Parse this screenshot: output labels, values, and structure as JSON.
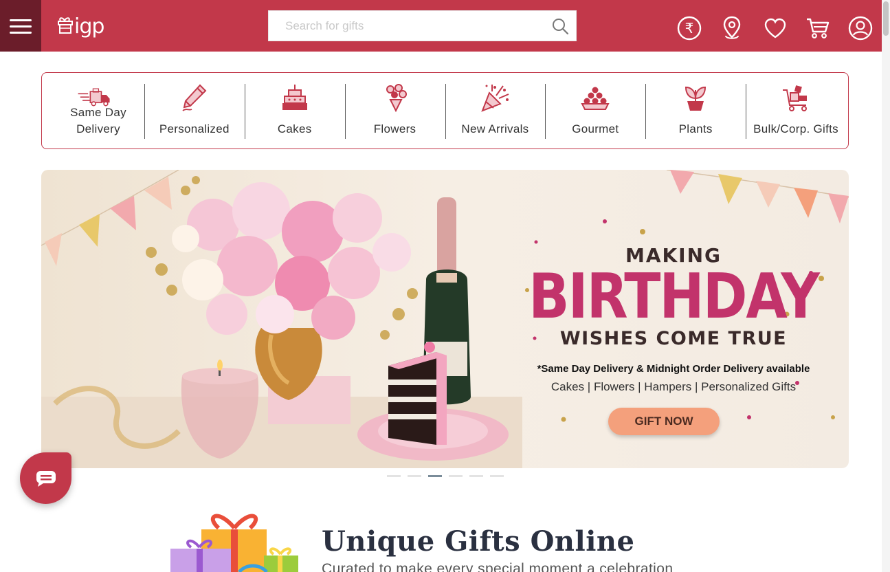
{
  "header": {
    "logo_text": "igp",
    "search_placeholder": "Search for gifts",
    "icons": [
      "currency-rupee-icon",
      "location-pin-icon",
      "heart-icon",
      "cart-icon",
      "user-icon"
    ]
  },
  "categories": [
    {
      "label": "Same Day Delivery",
      "icon": "delivery-truck-icon"
    },
    {
      "label": "Personalized",
      "icon": "pencil-icon"
    },
    {
      "label": "Cakes",
      "icon": "cake-icon"
    },
    {
      "label": "Flowers",
      "icon": "flowers-icon"
    },
    {
      "label": "New Arrivals",
      "icon": "party-popper-icon"
    },
    {
      "label": "Gourmet",
      "icon": "sweets-icon"
    },
    {
      "label": "Plants",
      "icon": "plant-icon"
    },
    {
      "label": "Bulk/Corp. Gifts",
      "icon": "corporate-gifts-icon"
    }
  ],
  "banner": {
    "line1": "MAKING",
    "line2": "BIRTHDAY",
    "line3": "WISHES COME TRUE",
    "note": "*Same Day Delivery & Midnight Order Delivery available",
    "categories_line": "Cakes | Flowers | Hampers | Personalized Gifts",
    "cta": "GIFT NOW"
  },
  "carousel": {
    "total": 6,
    "active": 3
  },
  "section": {
    "title": "Unique Gifts Online",
    "subtitle": "Curated to make every special moment a celebration"
  },
  "colors": {
    "brand": "#c2384a",
    "brand_dark": "#6b1d2a",
    "birthday_pink": "#c2336b",
    "cta": "#f4a07c"
  }
}
